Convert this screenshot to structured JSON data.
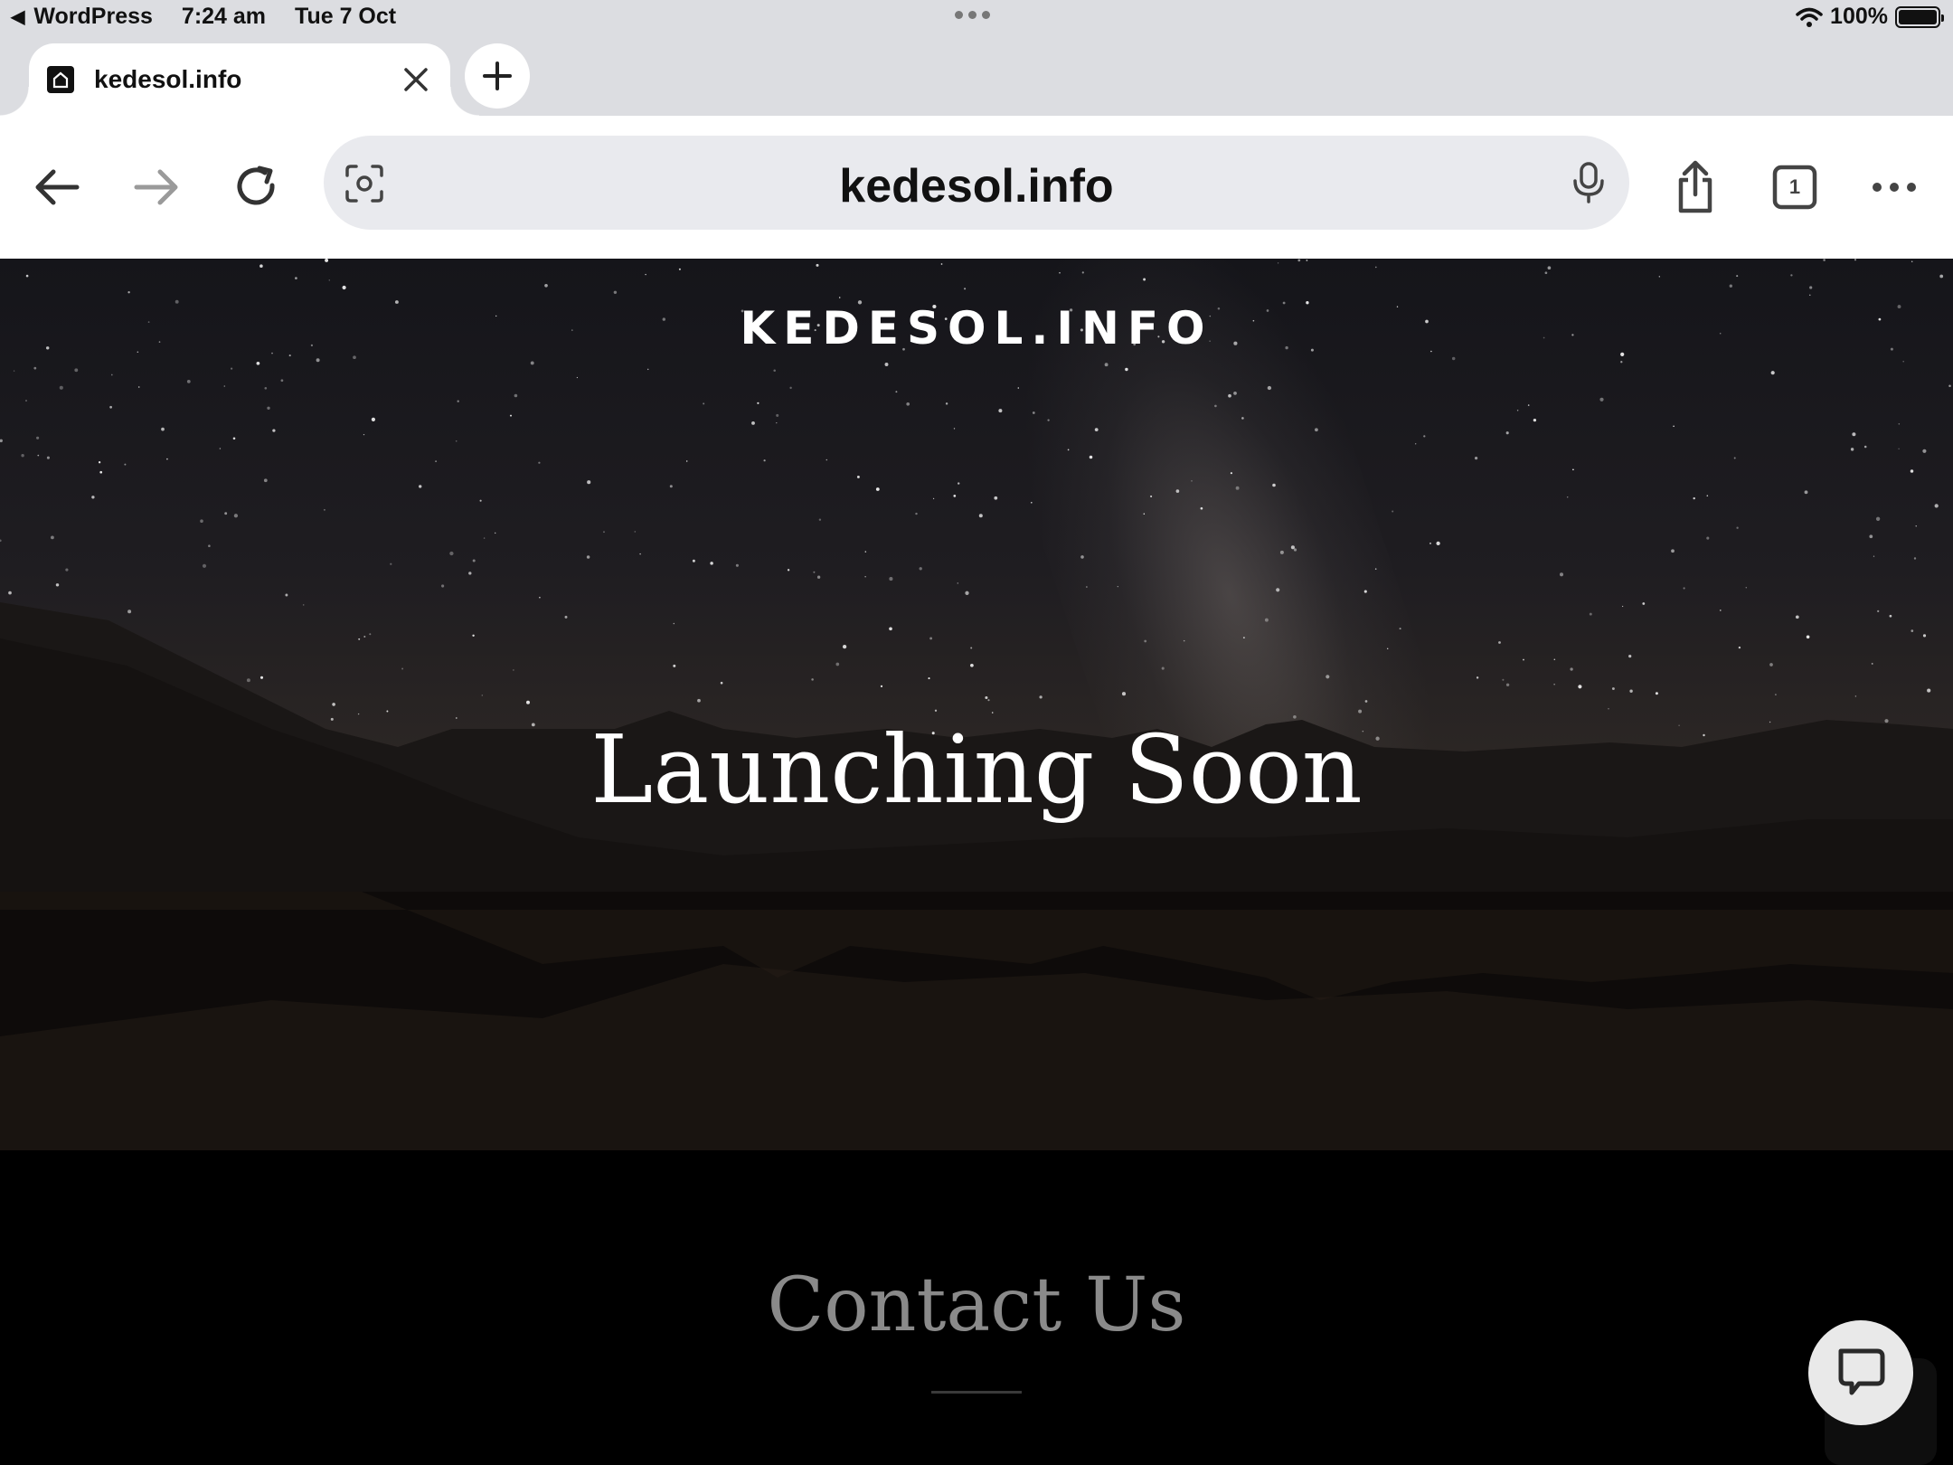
{
  "status_bar": {
    "back_app": "WordPress",
    "time": "7:24 am",
    "date": "Tue 7 Oct",
    "battery": "100%"
  },
  "tab": {
    "title": "kedesol.info"
  },
  "toolbar": {
    "url": "kedesol.info",
    "tab_count": "1"
  },
  "hero": {
    "site_name": "KEDESOL.INFO",
    "headline": "Launching Soon"
  },
  "contact": {
    "title": "Contact Us"
  },
  "icons": [
    "back-arrow-icon",
    "forward-arrow-icon",
    "reload-icon",
    "lens-icon",
    "mic-icon",
    "share-icon",
    "tabs-icon",
    "more-icon",
    "close-icon",
    "plus-icon",
    "wifi-icon",
    "battery-icon",
    "chat-icon"
  ]
}
